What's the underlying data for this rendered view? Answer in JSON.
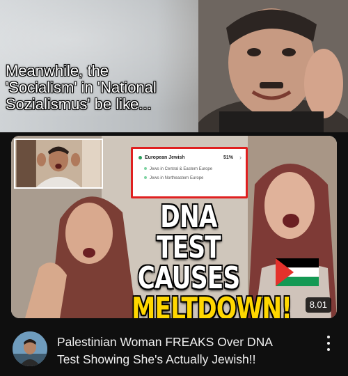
{
  "meme": {
    "caption_lines": [
      "Meanwhile, the",
      "'Socialism' in 'National",
      "Sozialismus' be like..."
    ]
  },
  "video": {
    "thumbnail": {
      "dna_card": {
        "heading": "European Jewish",
        "percent": "51%",
        "rows": [
          "Jews in Central & Eastern Europe",
          "Jews in Northeastern Europe"
        ]
      },
      "headline": [
        "DNA TEST",
        "CAUSES",
        "MELTDOWN!"
      ],
      "duration": "8.01"
    },
    "title_lines": [
      "Palestinian Woman FREAKS Over DNA",
      "Test Showing She's Actually Jewish!!"
    ]
  },
  "colors": {
    "background": "#0f0f0f",
    "headline_highlight": "#ffd700",
    "card_border": "#e02020"
  },
  "icons": [
    "more-vert-icon",
    "palestine-flag",
    "channel-avatar"
  ]
}
